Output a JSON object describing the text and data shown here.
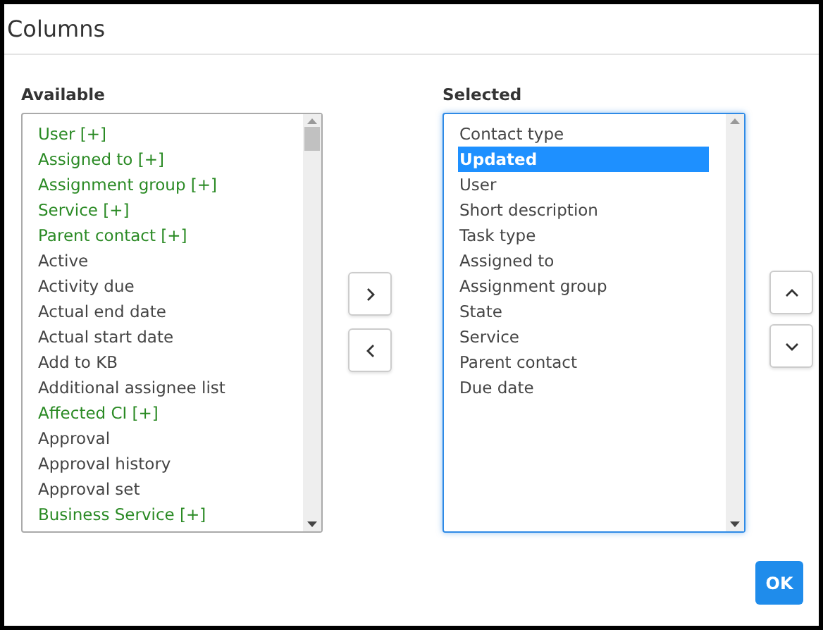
{
  "dialog": {
    "title": "Columns"
  },
  "available": {
    "label": "Available",
    "items": [
      {
        "text": "User [+]",
        "kind": "reference",
        "selected": false
      },
      {
        "text": "Assigned to [+]",
        "kind": "reference",
        "selected": false
      },
      {
        "text": "Assignment group [+]",
        "kind": "reference",
        "selected": false
      },
      {
        "text": "Service [+]",
        "kind": "reference",
        "selected": false
      },
      {
        "text": "Parent contact [+]",
        "kind": "reference",
        "selected": false
      },
      {
        "text": "Active",
        "kind": "field",
        "selected": false
      },
      {
        "text": "Activity due",
        "kind": "field",
        "selected": false
      },
      {
        "text": "Actual end date",
        "kind": "field",
        "selected": false
      },
      {
        "text": "Actual start date",
        "kind": "field",
        "selected": false
      },
      {
        "text": "Add to KB",
        "kind": "field",
        "selected": false
      },
      {
        "text": "Additional assignee list",
        "kind": "field",
        "selected": false
      },
      {
        "text": "Affected CI [+]",
        "kind": "reference",
        "selected": false
      },
      {
        "text": "Approval",
        "kind": "field",
        "selected": false
      },
      {
        "text": "Approval history",
        "kind": "field",
        "selected": false
      },
      {
        "text": "Approval set",
        "kind": "field",
        "selected": false
      },
      {
        "text": "Business Service [+]",
        "kind": "reference",
        "selected": false
      }
    ]
  },
  "selected": {
    "label": "Selected",
    "items": [
      {
        "text": "Contact type",
        "selected": false
      },
      {
        "text": "Updated",
        "selected": true
      },
      {
        "text": "User",
        "selected": false
      },
      {
        "text": "Short description",
        "selected": false
      },
      {
        "text": "Task type",
        "selected": false
      },
      {
        "text": "Assigned to",
        "selected": false
      },
      {
        "text": "Assignment group",
        "selected": false
      },
      {
        "text": "State",
        "selected": false
      },
      {
        "text": "Service",
        "selected": false
      },
      {
        "text": "Parent contact",
        "selected": false
      },
      {
        "text": "Due date",
        "selected": false
      }
    ]
  },
  "ok_button": "OK"
}
